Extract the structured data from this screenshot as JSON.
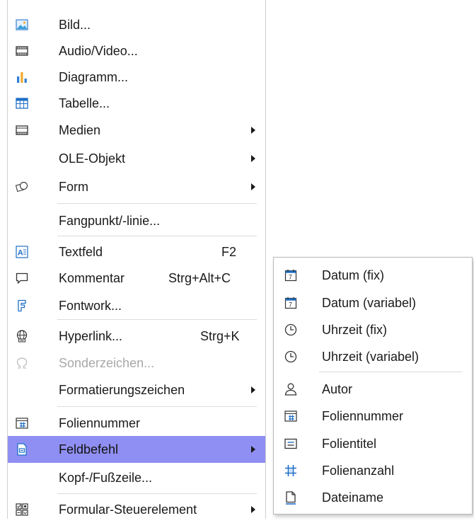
{
  "main_menu": [
    {
      "label": "Bild...",
      "icon": "image-icon"
    },
    {
      "label": "Audio/Video...",
      "icon": "film-icon"
    },
    {
      "label": "Diagramm...",
      "icon": "bar-chart-icon"
    },
    {
      "label": "Tabelle...",
      "icon": "table-icon"
    },
    {
      "label": "Medien",
      "icon": "media-icon"
    },
    {
      "label": "OLE-Objekt"
    },
    {
      "label": "Form",
      "icon": "shapes-icon"
    },
    {
      "label": "Fangpunkt/-linie..."
    },
    {
      "label": "Textfeld",
      "shortcut": "F2",
      "icon": "text-box-icon"
    },
    {
      "label": "Kommentar",
      "shortcut": "Strg+Alt+C",
      "icon": "comment-icon"
    },
    {
      "label": "Fontwork...",
      "icon": "fontwork-icon"
    },
    {
      "label": "Hyperlink...",
      "shortcut": "Strg+K",
      "icon": "globe-link-icon"
    },
    {
      "label": "Sonderzeichen...",
      "icon": "omega-icon"
    },
    {
      "label": "Formatierungszeichen"
    },
    {
      "label": "Foliennummer",
      "icon": "slide-number-icon"
    },
    {
      "label": "Feldbefehl",
      "icon": "field-icon"
    },
    {
      "label": "Kopf-/Fußzeile..."
    },
    {
      "label": "Formular-Steuerelement",
      "icon": "form-control-icon"
    }
  ],
  "submenu": [
    {
      "label": "Datum (fix)",
      "icon": "calendar-icon"
    },
    {
      "label": "Datum (variabel)",
      "icon": "calendar-icon"
    },
    {
      "label": "Uhrzeit (fix)",
      "icon": "clock-icon"
    },
    {
      "label": "Uhrzeit (variabel)",
      "icon": "clock-icon"
    },
    {
      "label": "Autor",
      "icon": "person-icon"
    },
    {
      "label": "Foliennummer",
      "icon": "slide-number-icon"
    },
    {
      "label": "Folientitel",
      "icon": "slide-title-icon"
    },
    {
      "label": "Folienanzahl",
      "icon": "slide-count-icon"
    },
    {
      "label": "Dateiname",
      "icon": "document-icon"
    }
  ],
  "colors": {
    "highlight": "#8f8ff3",
    "accent": "#1e6fc6",
    "disabled": "#a8a8a8"
  }
}
